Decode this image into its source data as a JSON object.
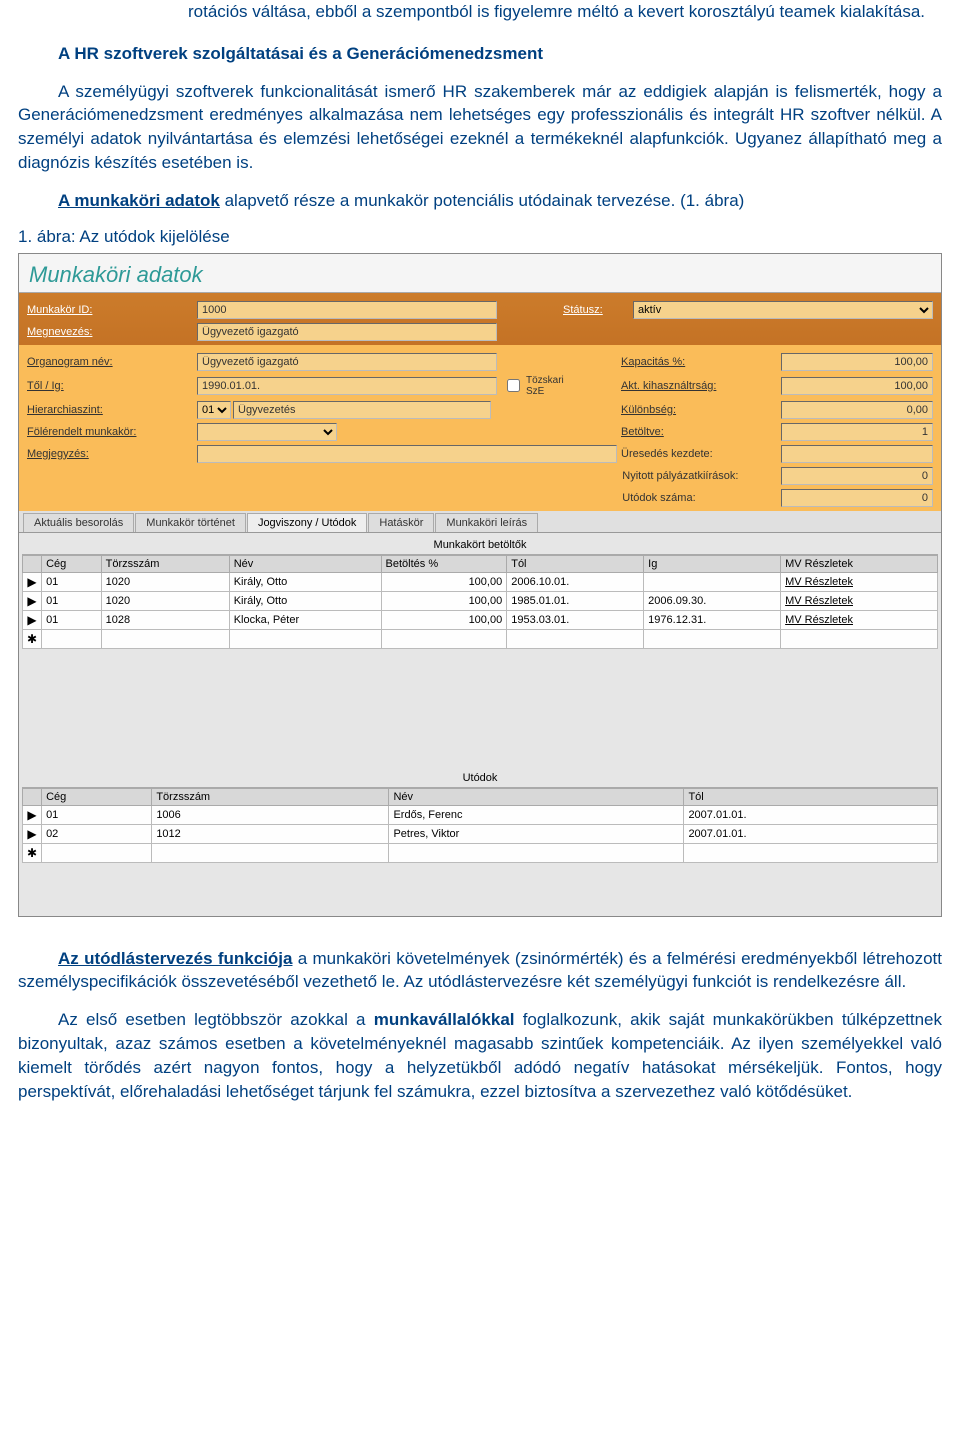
{
  "doc": {
    "para_intro": "rotációs váltása, ebből a szempontból is figyelemre méltó a kevert korosztályú teamek kialakítása.",
    "heading1": "A HR szoftverek szolgáltatásai és a Generációmenedzsment",
    "para_main": "A személyügyi szoftverek funkcionalitását ismerő HR szakemberek már az eddigiek alapján is felismerték, hogy a Generációmenedzsment eredményes alkalmazása nem lehetséges egy professzionális és integrált HR szoftver nélkül. A személyi adatok nyilvántartása és elemzési lehetőségei ezeknél a termékeknél alapfunkciók. Ugyanez állapítható meg a diagnózis készítés esetében is.",
    "para_munkakori_pre": "A munkaköri adatok",
    "para_munkakori_post": " alapvető része a munkakör potenciális utódainak tervezése. (1. ábra)",
    "fig_caption": "1. ábra: Az utódok kijelölése",
    "para_utod_pre": "Az utódlástervezés funkciója",
    "para_utod_post": " a munkaköri követelmények (zsinórmérték) és a felmérési eredményekből létrehozott személyspecifikációk összevetéséből vezethető le. Az utódlástervezésre két személyügyi funkciót is rendelkezésre áll.",
    "para_elsop1": "Az első esetben legtöbbször azokkal a ",
    "para_elsop2": "munkavállalókkal",
    "para_elsop3": " foglalkozunk, akik saját munkakörükben túlképzettnek bizonyultak, azaz számos esetben a követelményeknél magasabb szintűek kompetenciáik. Az ilyen személyekkel való kiemelt törődés azért nagyon fontos, hogy a helyzetükből adódó negatív hatásokat mérsékeljük. Fontos, hogy perspektívát, előrehaladási lehetőséget tárjunk fel számukra, ezzel biztosítva a szervezethez való kötődésüket."
  },
  "app": {
    "title": "Munkaköri adatok",
    "labels": {
      "munkakor_id": "Munkakör ID:",
      "statusz": "Státusz:",
      "megnevezes": "Megnevezés:",
      "organogram": "Organogram név:",
      "tol_ig": "Től / Ig:",
      "hierarch": "Hierarchiaszint:",
      "foler": "Fölérendelt munkakör:",
      "megjegy": "Megjegyzés:",
      "torzs_sze": "Tözskari SzE",
      "kapacitas": "Kapacitás %:",
      "akt_kih": "Akt. kihasználtrság:",
      "kulonb": "Különbség:",
      "betoltve": "Betöltve:",
      "uresedes": "Üresedés kezdete:",
      "nyitott": "Nyitott pályázatkiírások:",
      "utodok": "Utódok száma:"
    },
    "values": {
      "munkakor_id": "1000",
      "statusz": "aktív",
      "megnevezes": "Ügyvezető igazgató",
      "organogram": "Ügyvezető igazgató",
      "tol": "1990.01.01.",
      "hier_code": "01",
      "hier_text": "Ügyvezetés",
      "kapacitas": "100,00",
      "akt_kih": "100,00",
      "kulonb": "0,00",
      "betoltve": "1",
      "nyitott": "0",
      "utodok": "0"
    },
    "tabs": [
      "Aktuális besorolás",
      "Munkakör történet",
      "Jogviszony / Utódok",
      "Hatáskör",
      "Munkaköri leírás"
    ],
    "active_tab": 2,
    "grid1_title": "Munkakört betöltők",
    "grid1_headers": [
      "Cég",
      "Törzsszám",
      "Név",
      "Betöltés %",
      "Tól",
      "Ig",
      "MV Részletek"
    ],
    "grid1_rows": [
      {
        "ceg": "01",
        "torzs": "1020",
        "nev": "Király, Otto",
        "pct": "100,00",
        "tol": "2006.10.01.",
        "ig": "",
        "mv": "MV Részletek"
      },
      {
        "ceg": "01",
        "torzs": "1020",
        "nev": "Király, Otto",
        "pct": "100,00",
        "tol": "1985.01.01.",
        "ig": "2006.09.30.",
        "mv": "MV Részletek"
      },
      {
        "ceg": "01",
        "torzs": "1028",
        "nev": "Klocka, Péter",
        "pct": "100,00",
        "tol": "1953.03.01.",
        "ig": "1976.12.31.",
        "mv": "MV Részletek"
      }
    ],
    "grid2_title": "Utódok",
    "grid2_headers": [
      "Cég",
      "Törzsszám",
      "Név",
      "Tól"
    ],
    "grid2_rows": [
      {
        "ceg": "01",
        "torzs": "1006",
        "nev": "Erdős, Ferenc",
        "tol": "2007.01.01."
      },
      {
        "ceg": "02",
        "torzs": "1012",
        "nev": "Petres, Viktor",
        "tol": "2007.01.01."
      }
    ]
  }
}
